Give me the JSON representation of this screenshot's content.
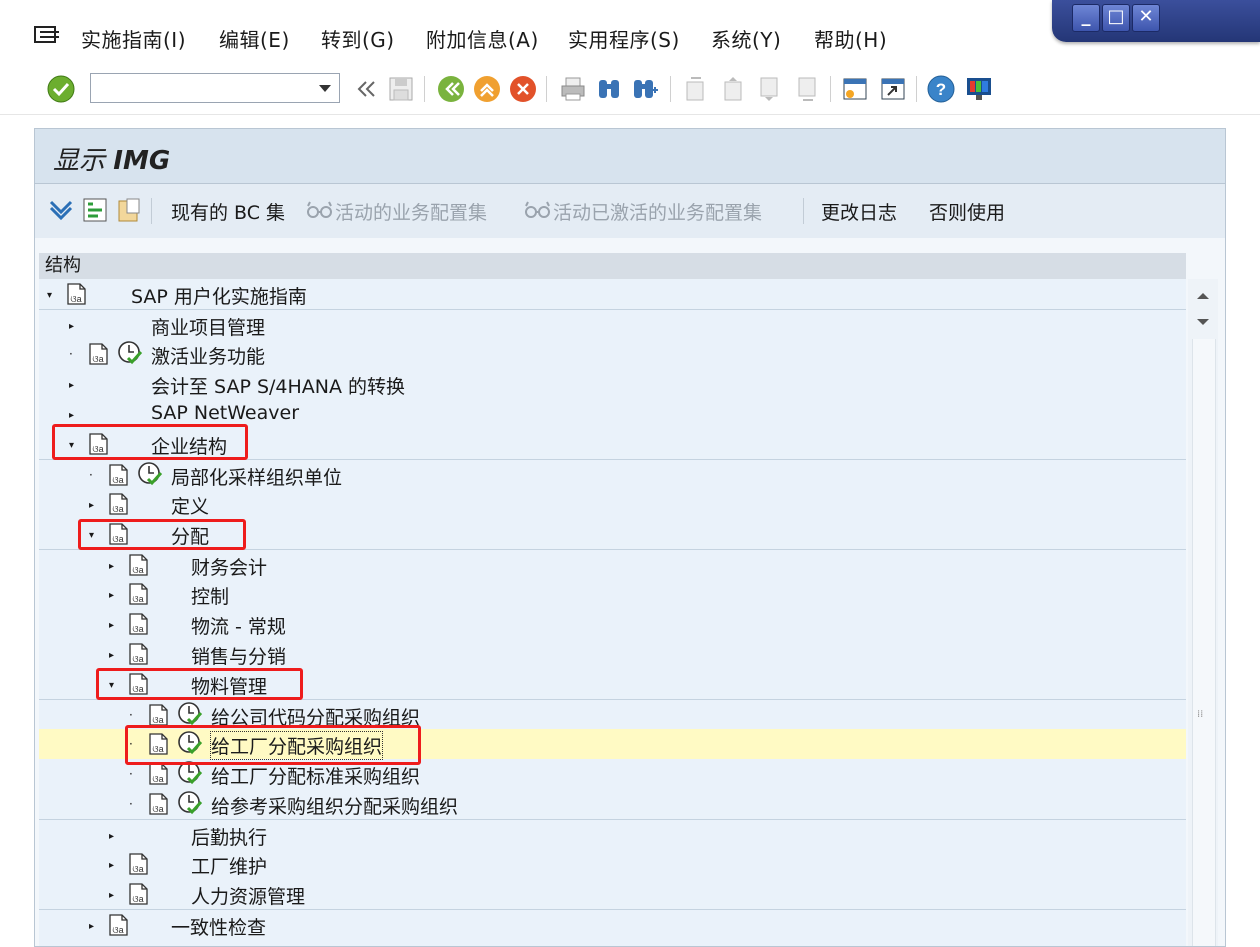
{
  "menubar": {
    "items": [
      {
        "label": "实施指南(I)"
      },
      {
        "label": "编辑(E)"
      },
      {
        "label": "转到(G)"
      },
      {
        "label": "附加信息(A)"
      },
      {
        "label": "实用程序(S)"
      },
      {
        "label": "系统(Y)"
      },
      {
        "label": "帮助(H)"
      }
    ]
  },
  "toolbar": {
    "command_field_value": "",
    "icons": [
      "enter-icon",
      "back-double-icon",
      "save-icon",
      "back-icon",
      "exit-icon",
      "cancel-icon",
      "print-icon",
      "find-icon",
      "find-next-icon",
      "first-page-icon",
      "previous-page-icon",
      "next-page-icon",
      "last-page-icon",
      "new-session-icon",
      "shortcut-icon",
      "help-icon",
      "layout-icon"
    ]
  },
  "frame": {
    "title_prefix": "显示",
    "title_main": "IMG"
  },
  "app_toolbar": {
    "existing_bc_sets": "现有的 BC 集",
    "active_bc_sets": "活动的业务配置集",
    "activated_bc_sets": "活动已激活的业务配置集",
    "change_log": "更改日志",
    "otherwise_use": "否则使用"
  },
  "tree": {
    "header": "结构",
    "rows": [
      {
        "label": "SAP 用户化实施指南"
      },
      {
        "label": "商业项目管理"
      },
      {
        "label": "激活业务功能"
      },
      {
        "label": "会计至 SAP S/4HANA 的转换"
      },
      {
        "label": "SAP NetWeaver"
      },
      {
        "label": "企业结构"
      },
      {
        "label": "局部化采样组织单位"
      },
      {
        "label": "定义"
      },
      {
        "label": "分配"
      },
      {
        "label": "财务会计"
      },
      {
        "label": "控制"
      },
      {
        "label": "物流 - 常规"
      },
      {
        "label": "销售与分销"
      },
      {
        "label": "物料管理"
      },
      {
        "label": "给公司代码分配采购组织"
      },
      {
        "label": "给工厂分配采购组织"
      },
      {
        "label": "给工厂分配标准采购组织"
      },
      {
        "label": "给参考采购组织分配采购组织"
      },
      {
        "label": "后勤执行"
      },
      {
        "label": "工厂维护"
      },
      {
        "label": "人力资源管理"
      },
      {
        "label": "一致性检查"
      }
    ]
  },
  "colors": {
    "highlight_red": "#ee1c1c",
    "selected_row": "#fffac4",
    "tree_bg": "#eaf2fa"
  }
}
